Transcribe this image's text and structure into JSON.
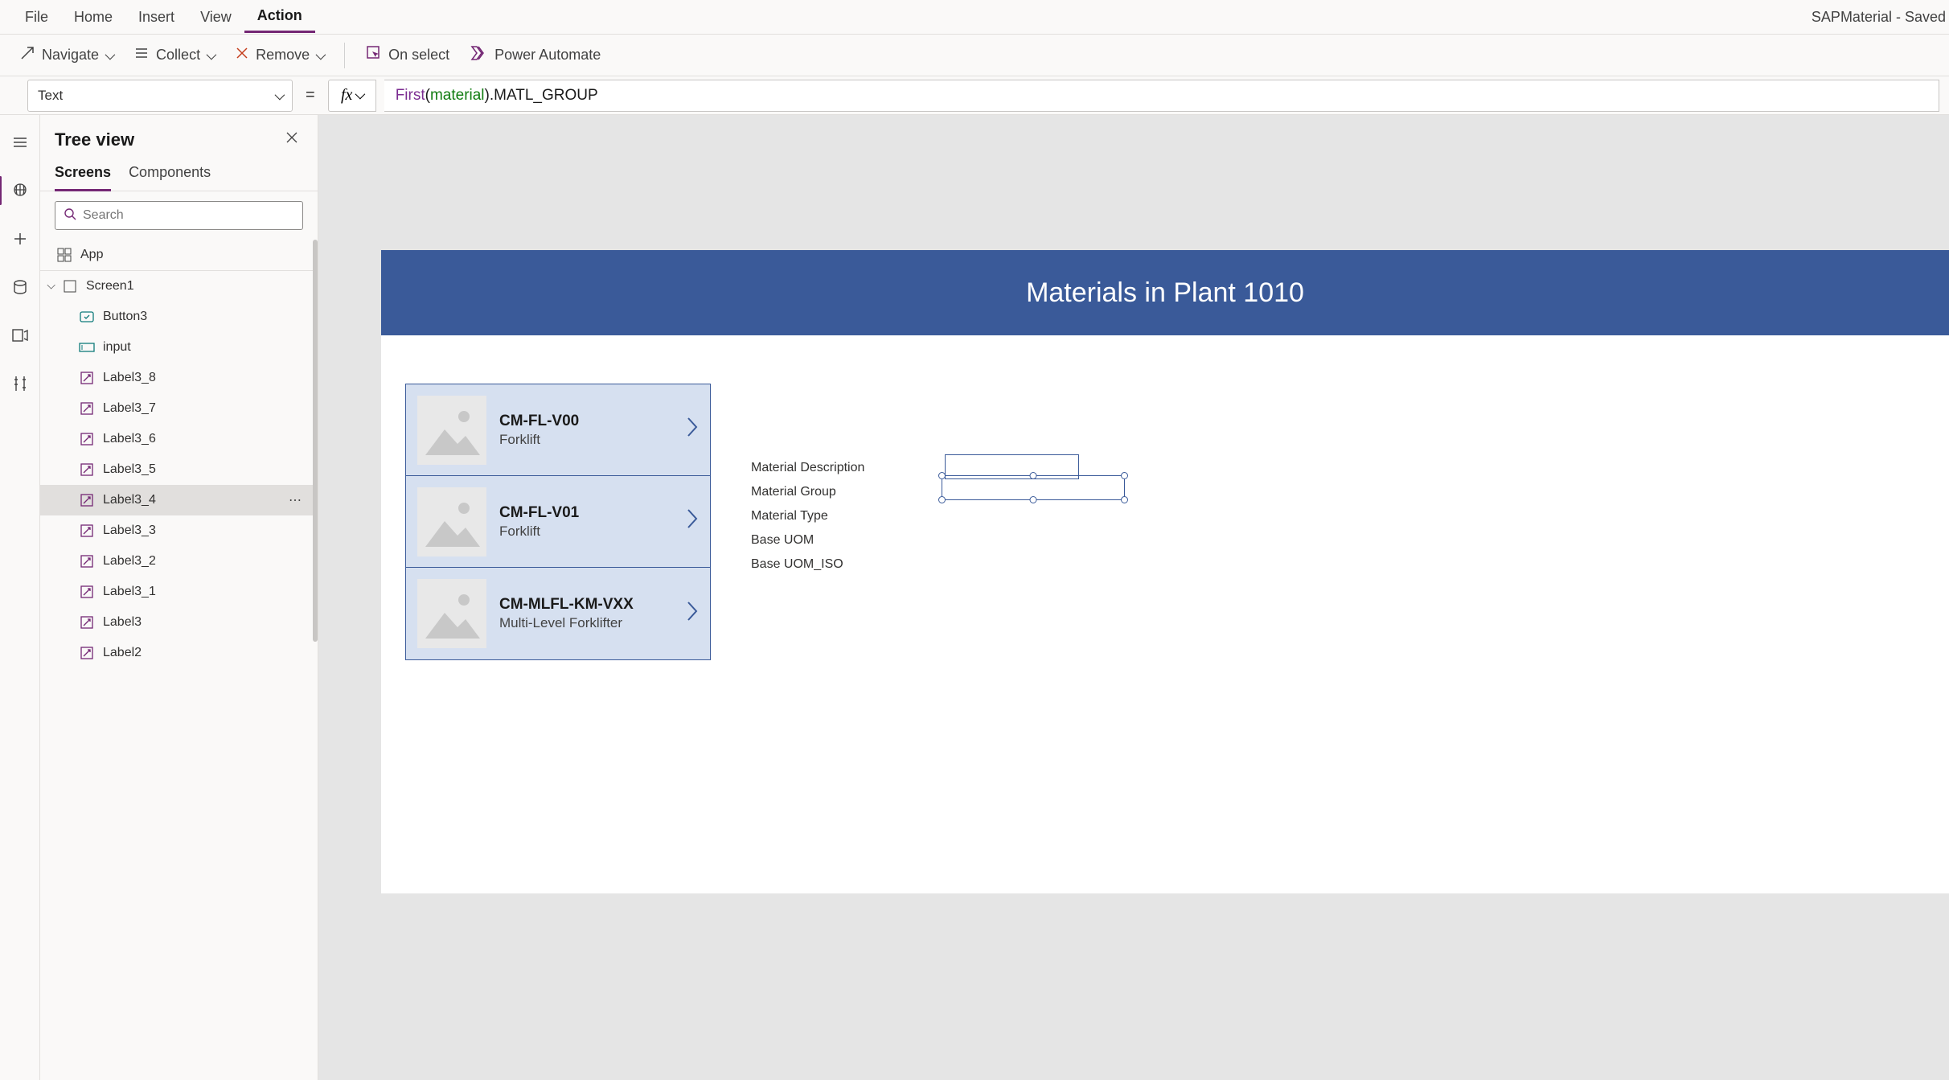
{
  "menubar": {
    "items": [
      "File",
      "Home",
      "Insert",
      "View",
      "Action"
    ],
    "active_index": 4,
    "doc_title": "SAPMaterial - Saved"
  },
  "ribbon": {
    "navigate": "Navigate",
    "collect": "Collect",
    "remove": "Remove",
    "on_select": "On select",
    "power_automate": "Power Automate"
  },
  "formula": {
    "property": "Text",
    "fx_label": "fx",
    "value_raw": "First(material).MATL_GROUP",
    "tokens": [
      {
        "t": "First",
        "c": "violet"
      },
      {
        "t": "(",
        "c": "plain"
      },
      {
        "t": "material",
        "c": "green"
      },
      {
        "t": ")",
        "c": "plain"
      },
      {
        "t": ".MATL_GROUP",
        "c": "plain"
      }
    ]
  },
  "treeview": {
    "title": "Tree view",
    "tabs": [
      "Screens",
      "Components"
    ],
    "active_tab": 0,
    "search_placeholder": "Search",
    "app_label": "App",
    "screen_label": "Screen1",
    "children": [
      {
        "name": "Button3",
        "type": "button"
      },
      {
        "name": "input",
        "type": "input"
      },
      {
        "name": "Label3_8",
        "type": "label"
      },
      {
        "name": "Label3_7",
        "type": "label"
      },
      {
        "name": "Label3_6",
        "type": "label"
      },
      {
        "name": "Label3_5",
        "type": "label"
      },
      {
        "name": "Label3_4",
        "type": "label",
        "selected": true
      },
      {
        "name": "Label3_3",
        "type": "label"
      },
      {
        "name": "Label3_2",
        "type": "label"
      },
      {
        "name": "Label3_1",
        "type": "label"
      },
      {
        "name": "Label3",
        "type": "label"
      },
      {
        "name": "Label2",
        "type": "label"
      }
    ]
  },
  "canvas": {
    "header_title": "Materials in Plant 1010",
    "gallery": [
      {
        "title": "CM-FL-V00",
        "subtitle": "Forklift"
      },
      {
        "title": "CM-FL-V01",
        "subtitle": "Forklift"
      },
      {
        "title": "CM-MLFL-KM-VXX",
        "subtitle": "Multi-Level Forklifter"
      }
    ],
    "detail_labels": [
      "Material Description",
      "Material Group",
      "Material Type",
      "Base UOM",
      "Base UOM_ISO"
    ]
  }
}
